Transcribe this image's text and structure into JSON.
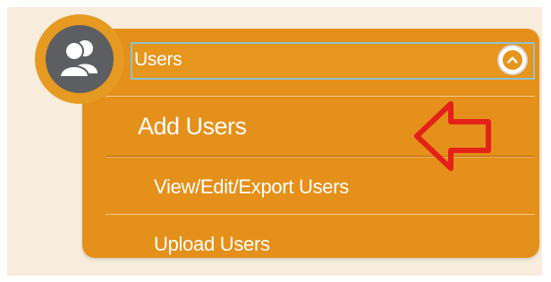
{
  "menu": {
    "title": "Users",
    "items": [
      {
        "label": "Add Users"
      },
      {
        "label": "View/Edit/Export Users"
      },
      {
        "label": "Upload Users"
      }
    ]
  },
  "icons": {
    "avatar": "users-icon",
    "toggle": "chevron-up-icon",
    "annotation": "left-arrow-icon"
  },
  "colors": {
    "background": "#f8ecdc",
    "menu": "#e4901a",
    "avatar_ring": "#e69a22",
    "avatar": "#5c5e62",
    "header_outline": "#8ec3d0",
    "annotation": "#e32119",
    "text": "#ffffff"
  }
}
